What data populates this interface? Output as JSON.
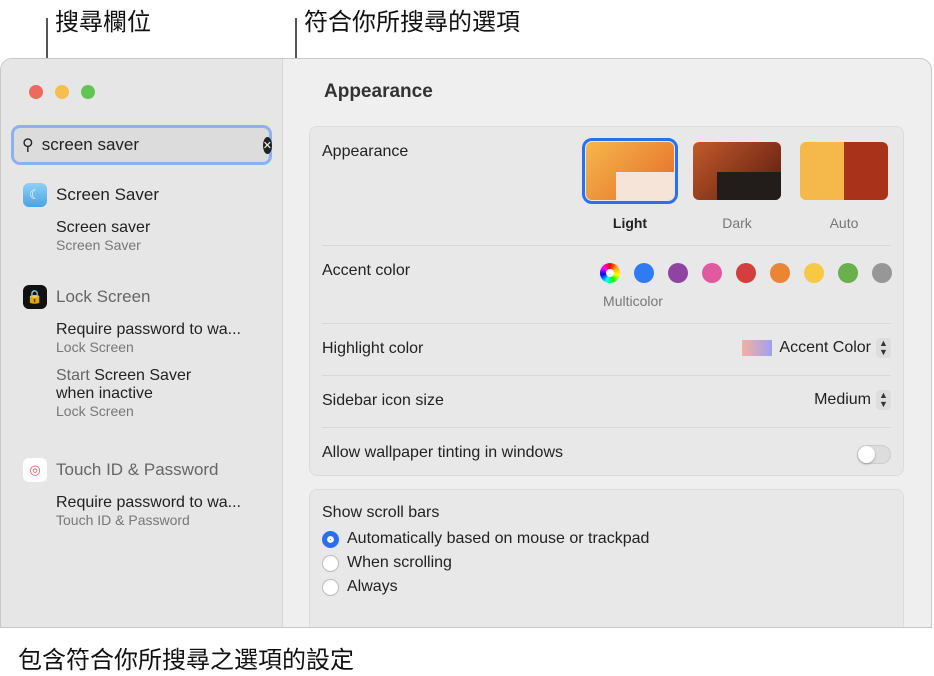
{
  "callouts": {
    "search_field": "搜尋欄位",
    "matching_options": "符合你所搜尋的選項",
    "settings_with_matches": "包含符合你所搜尋之選項的設定"
  },
  "search": {
    "value": "screen saver"
  },
  "results": [
    {
      "title": "Screen Saver",
      "icon": "screen-saver-icon",
      "items": [
        {
          "t": "Screen saver",
          "s": "Screen Saver"
        }
      ]
    },
    {
      "title": "Lock Screen",
      "icon": "lock-icon",
      "items": [
        {
          "t": "Require password to wa...",
          "s": "Lock Screen"
        },
        {
          "t1": "Start ",
          "t2": "Screen Saver",
          "t3": "when inactive",
          "s": "Lock Screen"
        }
      ]
    },
    {
      "title": "Touch ID & Password",
      "icon": "fingerprint-icon",
      "items": [
        {
          "t": "Require password to wa...",
          "s": "Touch ID & Password"
        }
      ]
    }
  ],
  "main": {
    "title": "Appearance",
    "appearance": {
      "label": "Appearance",
      "options": [
        "Light",
        "Dark",
        "Auto"
      ],
      "selected": "Light"
    },
    "accent": {
      "label": "Accent color",
      "selected_label": "Multicolor",
      "colors": [
        "#2f7af5",
        "#8e44a0",
        "#e05a9f",
        "#d33f3f",
        "#ea8534",
        "#f6c844",
        "#6ab04c",
        "#979797"
      ]
    },
    "highlight": {
      "label": "Highlight color",
      "value": "Accent Color"
    },
    "sidebar_icon": {
      "label": "Sidebar icon size",
      "value": "Medium"
    },
    "tinting": {
      "label": "Allow wallpaper tinting in windows",
      "on": false
    },
    "scroll": {
      "label": "Show scroll bars",
      "options": [
        "Automatically based on mouse or trackpad",
        "When scrolling",
        "Always"
      ],
      "selected": 0
    }
  }
}
